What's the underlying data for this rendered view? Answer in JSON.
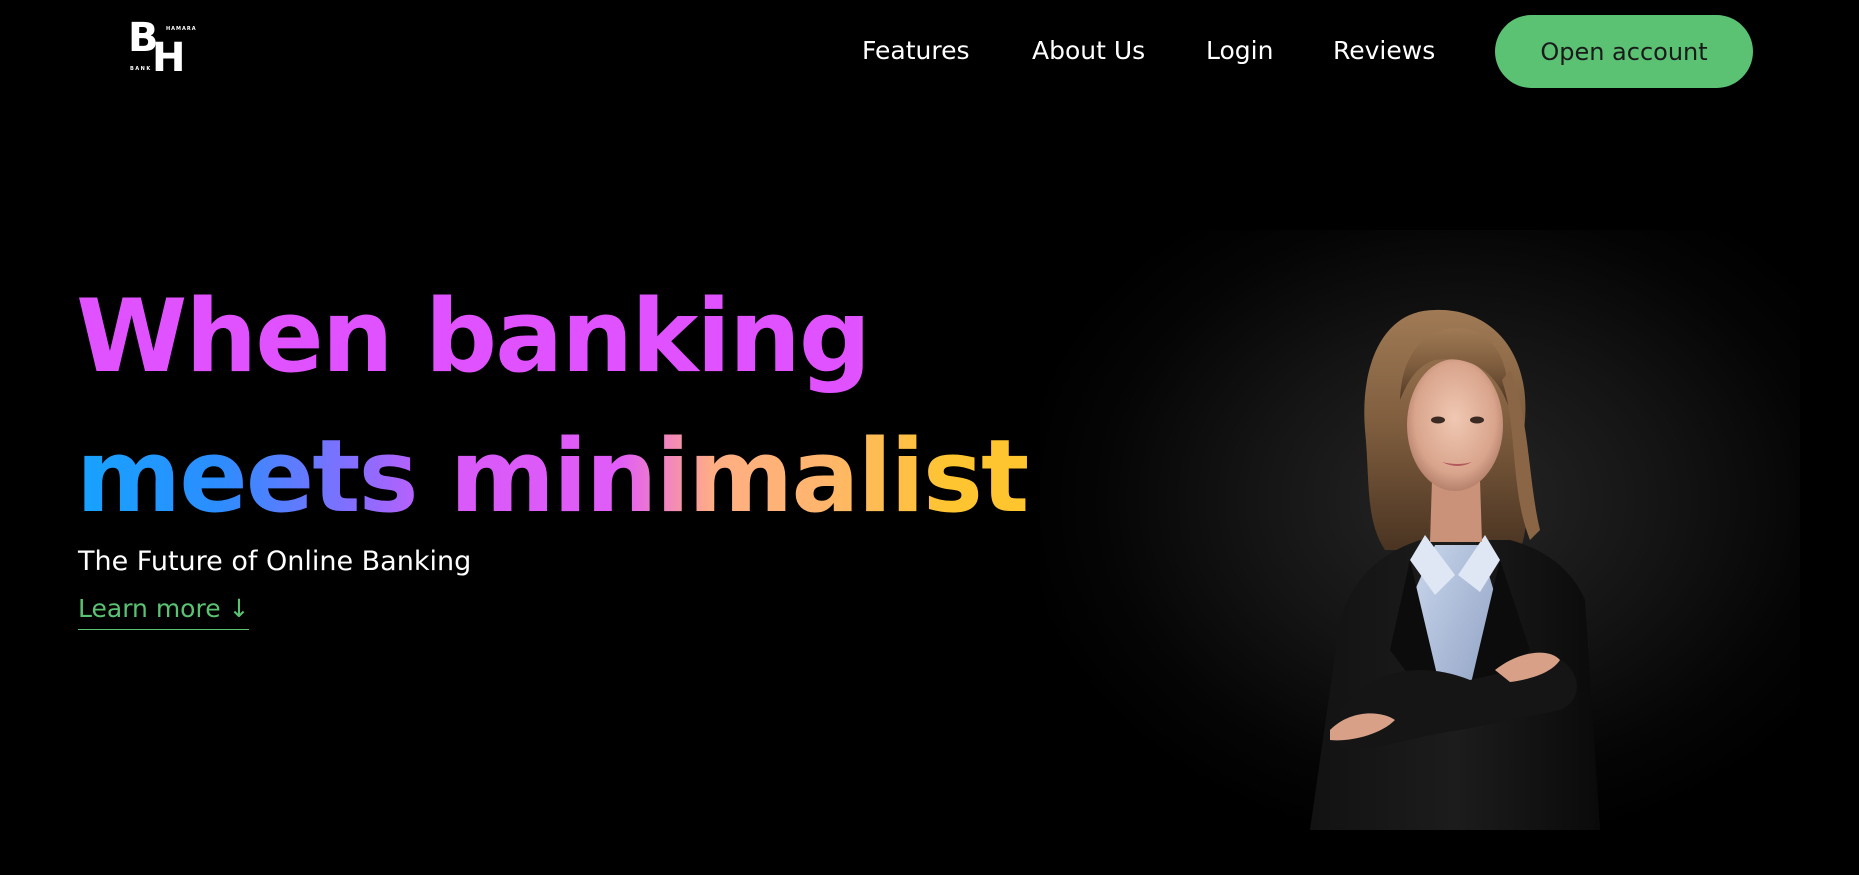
{
  "brand": {
    "logo_main": "BH",
    "logo_top_text": "HAMARA",
    "logo_side_text": "BANK"
  },
  "nav": {
    "items": [
      {
        "label": "Features"
      },
      {
        "label": "About Us"
      },
      {
        "label": "Login"
      },
      {
        "label": "Reviews"
      }
    ],
    "cta_label": "Open account"
  },
  "hero": {
    "headline_line1": "When banking",
    "headline_line2": "meets minimalist",
    "subtitle": "The Future of Online Banking",
    "learn_more": "Learn more ↓"
  },
  "colors": {
    "background": "#000000",
    "accent_green": "#5bc274",
    "gradient_magenta": "#e052ff",
    "gradient_blue": "#16a3ff",
    "gradient_peach": "#ffad86",
    "gradient_yellow": "#ffc52f"
  },
  "images": {
    "portrait": "woman-in-black-blazer-portrait"
  }
}
